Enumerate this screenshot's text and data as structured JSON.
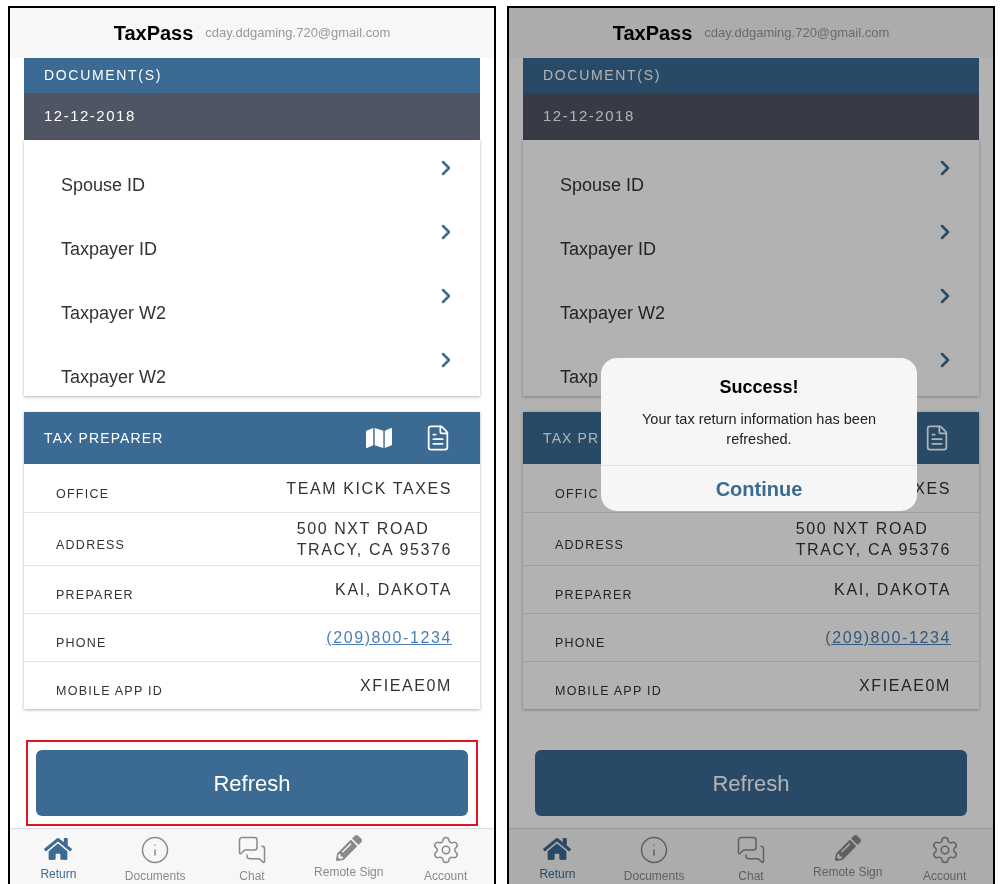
{
  "screens": [
    {
      "dimmed": false,
      "header": {
        "title": "TaxPass",
        "email": "cday.ddgaming.720@gmail.com"
      },
      "documents": {
        "title": "DOCUMENT(S)",
        "date": "12-12-2018",
        "items": [
          {
            "label": "Spouse ID"
          },
          {
            "label": "Taxpayer ID"
          },
          {
            "label": "Taxpayer W2"
          },
          {
            "label": "Taxpayer W2"
          }
        ]
      },
      "preparer": {
        "title": "TAX PREPARER",
        "icons": [
          {
            "kind": "map"
          },
          {
            "kind": "notes"
          }
        ],
        "rows": [
          {
            "kind": "text",
            "label": "OFFICE",
            "value_lines": [
              "TEAM KICK TAXES"
            ]
          },
          {
            "kind": "text",
            "label": "ADDRESS",
            "value_lines": [
              "500 NXT ROAD",
              "TRACY, CA 95376"
            ]
          },
          {
            "kind": "text",
            "label": "PREPARER",
            "value_lines": [
              "KAI, DAKOTA"
            ]
          },
          {
            "kind": "link",
            "label": "PHONE",
            "value_lines": [
              "(209)800-1234"
            ]
          },
          {
            "kind": "text",
            "label": "MOBILE APP ID",
            "value_lines": [
              "XFIEAE0M"
            ]
          }
        ]
      },
      "refresh": {
        "label": "Refresh",
        "highlighted": true
      },
      "tabs": [
        {
          "kind": "home",
          "label": "Return",
          "selected": true
        },
        {
          "kind": "info",
          "label": "Documents",
          "selected": false
        },
        {
          "kind": "chat",
          "label": "Chat",
          "selected": false
        },
        {
          "kind": "pencil",
          "label": "Remote Sign",
          "selected": false
        },
        {
          "kind": "gear",
          "label": "Account",
          "selected": false
        }
      ]
    },
    {
      "dimmed": true,
      "header": {
        "title": "TaxPass",
        "email": "cday.ddgaming.720@gmail.com"
      },
      "documents": {
        "title": "DOCUMENT(S)",
        "date": "12-12-2018",
        "items": [
          {
            "label": "Spouse ID"
          },
          {
            "label": "Taxpayer ID"
          },
          {
            "label": "Taxpayer W2"
          },
          {
            "label": "Taxp"
          }
        ]
      },
      "preparer": {
        "title": "TAX PR",
        "icons": [
          {
            "kind": "notes"
          }
        ],
        "rows": [
          {
            "kind": "text",
            "label": "OFFIC",
            "value_lines": [
              "XES"
            ]
          },
          {
            "kind": "text",
            "label": "ADDRESS",
            "value_lines": [
              "500 NXT ROAD",
              "TRACY, CA 95376"
            ]
          },
          {
            "kind": "text",
            "label": "PREPARER",
            "value_lines": [
              "KAI, DAKOTA"
            ]
          },
          {
            "kind": "link",
            "label": "PHONE",
            "value_lines": [
              "(209)800-1234"
            ]
          },
          {
            "kind": "text",
            "label": "MOBILE APP ID",
            "value_lines": [
              "XFIEAE0M"
            ]
          }
        ]
      },
      "refresh": {
        "label": "Refresh",
        "highlighted": false
      },
      "tabs": [
        {
          "kind": "home",
          "label": "Return",
          "selected": true
        },
        {
          "kind": "info",
          "label": "Documents",
          "selected": false
        },
        {
          "kind": "chat",
          "label": "Chat",
          "selected": false
        },
        {
          "kind": "pencil",
          "label": "Remote Sign",
          "selected": false
        },
        {
          "kind": "gear",
          "label": "Account",
          "selected": false
        }
      ],
      "dialog": {
        "title": "Success!",
        "message": "Your tax return information has been refreshed.",
        "button": "Continue"
      }
    }
  ]
}
